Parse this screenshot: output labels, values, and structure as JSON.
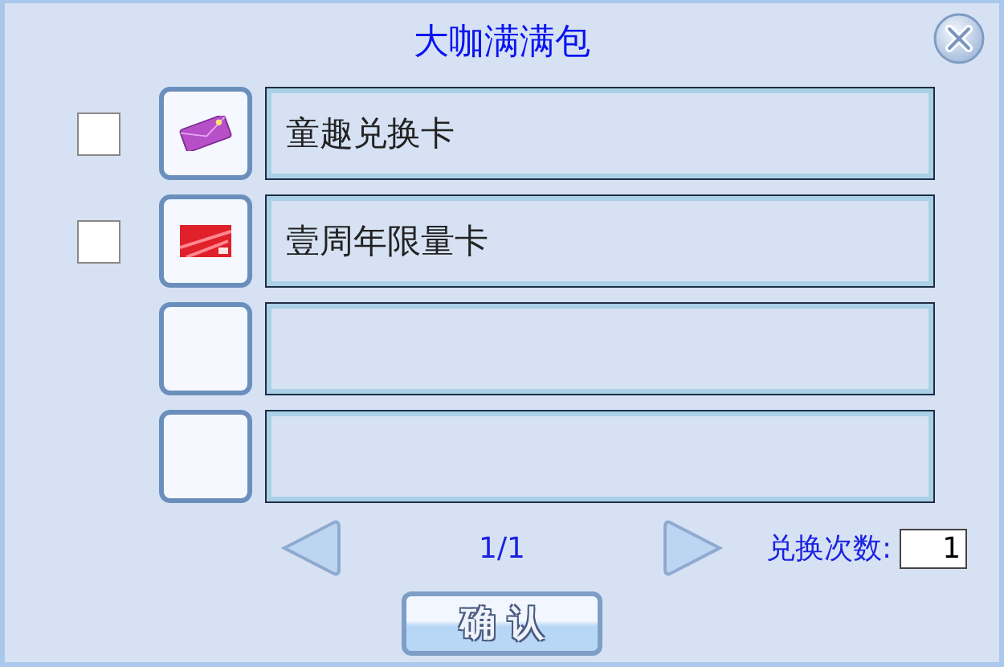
{
  "title": "大咖满满包",
  "slots": [
    {
      "kind": "pack",
      "checked": false,
      "name": "童趣兑换卡"
    },
    {
      "kind": "card",
      "checked": false,
      "name": "壹周年限量卡"
    },
    {
      "kind": "empty"
    },
    {
      "kind": "empty"
    }
  ],
  "pager": {
    "page": "1/1"
  },
  "exchange": {
    "label": "兑换次数:",
    "value": "1"
  },
  "confirm": "确 认"
}
